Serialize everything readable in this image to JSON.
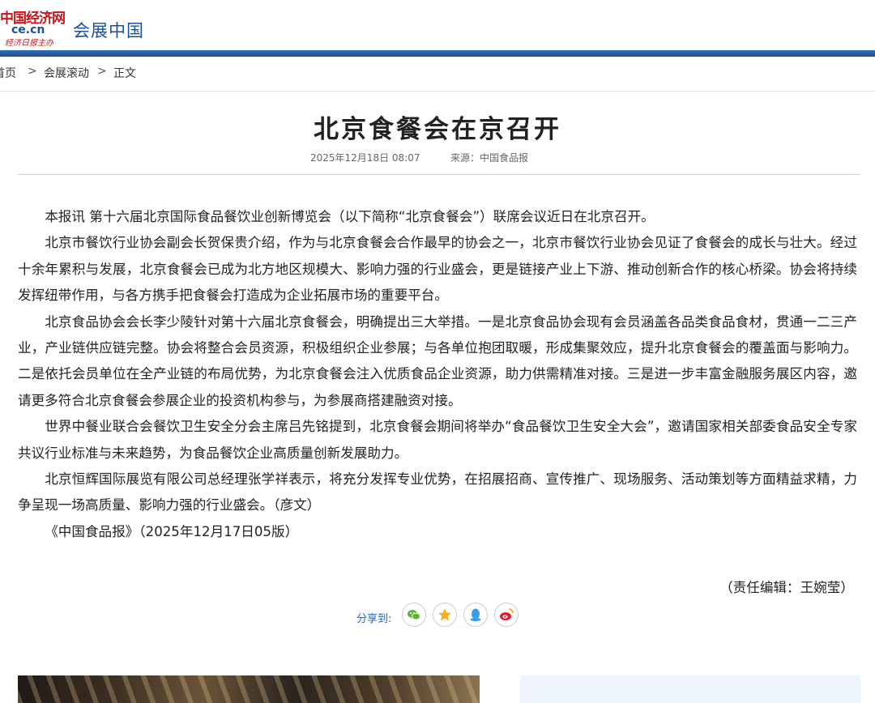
{
  "header": {
    "logo_line1": "中国经济网",
    "logo_line2": "ce.cn",
    "logo_line3": "经济日报主办",
    "site_title": "会展中国"
  },
  "breadcrumb": {
    "items": [
      "首页",
      "会展滚动",
      "正文"
    ],
    "separator": ">"
  },
  "article": {
    "title": "北京食餐会在京召开",
    "date": "2025年12月18日  08:07",
    "source": "来源：中国食品报",
    "paragraphs": [
      "本报讯 第十六届北京国际食品餐饮业创新博览会（以下简称“北京食餐会”）联席会议近日在北京召开。",
      "北京市餐饮行业协会副会长贺保贵介绍，作为与北京食餐会合作最早的协会之一，北京市餐饮行业协会见证了食餐会的成长与壮大。经过十余年累积与发展，北京食餐会已成为北方地区规模大、影响力强的行业盛会，更是链接产业上下游、推动创新合作的核心桥梁。协会将持续发挥纽带作用，与各方携手把食餐会打造成为企业拓展市场的重要平台。",
      "北京食品协会会长李少陵针对第十六届北京食餐会，明确提出三大举措。一是北京食品协会现有会员涵盖各品类食品食材，贯通一二三产业，产业链供应链完整。协会将整合会员资源，积极组织企业参展；与各单位抱团取暖，形成集聚效应，提升北京食餐会的覆盖面与影响力。二是依托会员单位在全产业链的布局优势，为北京食餐会注入优质食品企业资源，助力供需精准对接。三是进一步丰富金融服务展区内容，邀请更多符合北京食餐会参展企业的投资机构参与，为参展商搭建融资对接。",
      "世界中餐业联合会餐饮卫生安全分会主席吕先铭提到，北京食餐会期间将举办“食品餐饮卫生安全大会”，邀请国家相关部委食品安全专家共议行业标准与未来趋势，为食品餐饮企业高质量创新发展助力。",
      "北京恒辉国际展览有限公司总经理张学祥表示，将充分发挥专业优势，在招展招商、宣传推广、现场服务、活动策划等方面精益求精，力争呈现一场高质量、影响力强的行业盛会。（彦文）",
      "《中国食品报》（2025年12月17日05版）"
    ],
    "editor": "（责任编辑：王婉莹）"
  },
  "share": {
    "label": "分享到:",
    "icons": [
      "wechat-icon",
      "qzone-icon",
      "qq-icon",
      "weibo-icon"
    ]
  },
  "colors": {
    "brand_red": "#c8161d",
    "brand_blue": "#1b4f9c",
    "nav_blue": "#2468b4"
  }
}
